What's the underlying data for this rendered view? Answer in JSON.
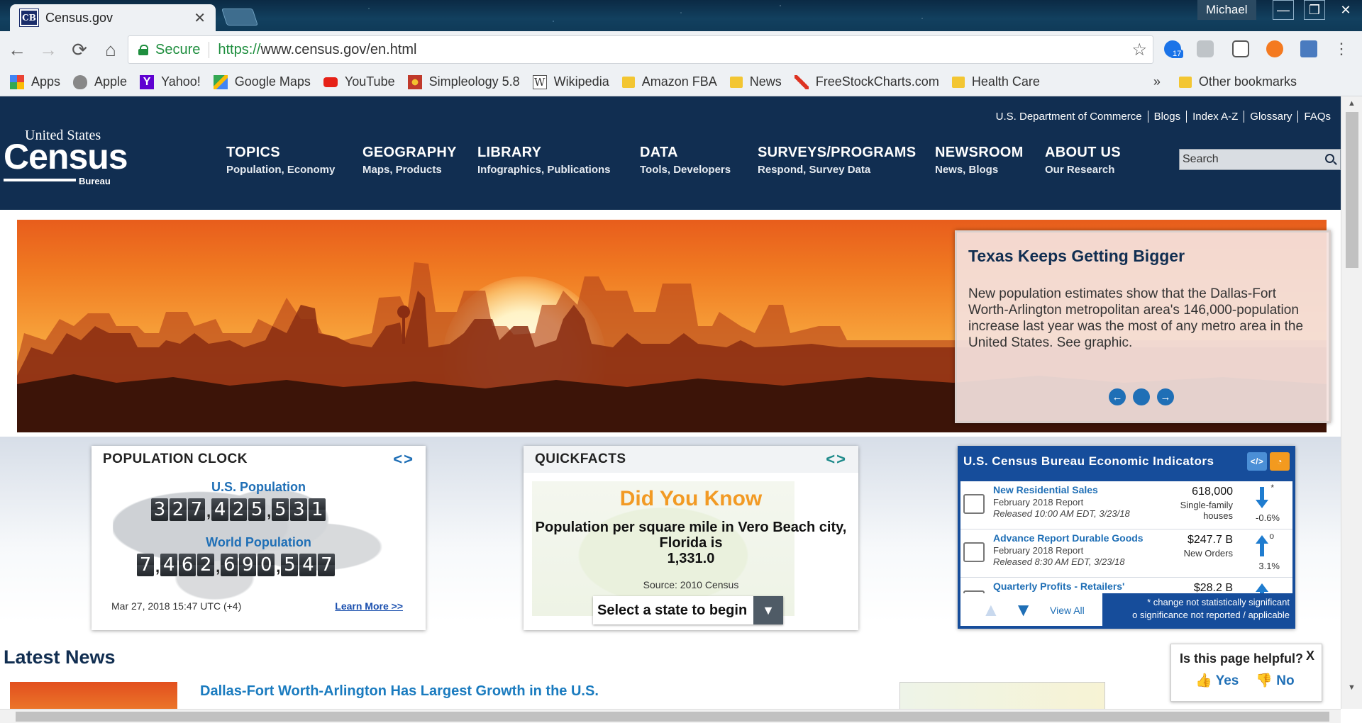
{
  "browser": {
    "tab_title": "Census.gov",
    "tab_favicon": "CB",
    "user": "Michael",
    "secure_label": "Secure",
    "url_scheme": "https://",
    "url_rest": "www.census.gov/en.html",
    "ext_badge": "17"
  },
  "bookmarks": [
    {
      "label": "Apps",
      "icon": "apps-grid-icon"
    },
    {
      "label": "Apple",
      "icon": "apple-icon"
    },
    {
      "label": "Yahoo!",
      "icon": "yahoo-icon"
    },
    {
      "label": "Google Maps",
      "icon": "maps-icon"
    },
    {
      "label": "YouTube",
      "icon": "youtube-icon"
    },
    {
      "label": "Simpleology 5.8",
      "icon": "simpleology-icon"
    },
    {
      "label": "Wikipedia",
      "icon": "wikipedia-icon"
    },
    {
      "label": "Amazon FBA",
      "icon": "folder-icon"
    },
    {
      "label": "News",
      "icon": "folder-icon"
    },
    {
      "label": "FreeStockCharts.com",
      "icon": "chart-icon"
    },
    {
      "label": "Health Care",
      "icon": "folder-icon"
    }
  ],
  "bookmarks_more": "»",
  "other_bookmarks": "Other bookmarks",
  "utility_links": [
    "U.S. Department of Commerce",
    "Blogs",
    "Index A-Z",
    "Glossary",
    "FAQs"
  ],
  "logo": {
    "top": "United States",
    "main": "Census",
    "bottom": "Bureau"
  },
  "nav": [
    {
      "title": "TOPICS",
      "sub": "Population, Economy"
    },
    {
      "title": "GEOGRAPHY",
      "sub": "Maps, Products"
    },
    {
      "title": "LIBRARY",
      "sub": "Infographics, Publications"
    },
    {
      "title": "DATA",
      "sub": "Tools, Developers"
    },
    {
      "title": "SURVEYS/PROGRAMS",
      "sub": "Respond, Survey Data"
    },
    {
      "title": "NEWSROOM",
      "sub": "News, Blogs"
    },
    {
      "title": "ABOUT US",
      "sub": "Our Research"
    }
  ],
  "search_placeholder": "Search",
  "hero": {
    "title": "Texas Keeps Getting Bigger",
    "body": "New population estimates show that the Dallas-Fort Worth-Arlington metropolitan area's 146,000-population increase last year was the most of any metro area in the United States. See graphic."
  },
  "population_clock": {
    "title": "POPULATION CLOCK",
    "us_label": "U.S. Population",
    "us_digits": [
      "3",
      "2",
      "7",
      ",",
      "4",
      "2",
      "5",
      ",",
      "5",
      "3",
      "1"
    ],
    "world_label": "World Population",
    "world_digits": [
      "7",
      ",",
      "4",
      "6",
      "2",
      ",",
      "6",
      "9",
      "0",
      ",",
      "5",
      "4",
      "7"
    ],
    "timestamp": "Mar 27, 2018 15:47 UTC (+4)",
    "learn_more": "Learn More >>"
  },
  "quickfacts": {
    "title": "QUICKFACTS",
    "heading": "Did You Know",
    "fact_line": "Population per square mile in Vero Beach city, Florida is",
    "fact_value": "1,331.0",
    "source": "Source: 2010 Census",
    "select": "Select a state to begin"
  },
  "economic": {
    "title": "U.S. Census Bureau Economic Indicators",
    "rows": [
      {
        "name": "New Residential Sales",
        "report": "February 2018 Report",
        "released": "Released 10:00 AM EDT, 3/23/18",
        "value": "618,000",
        "unit": "Single-family houses",
        "change": "-0.6%",
        "direction": "down",
        "mark": "*"
      },
      {
        "name": "Advance Report Durable Goods",
        "report": "February 2018 Report",
        "released": "Released 8:30 AM EDT, 3/23/18",
        "value": "$247.7 B",
        "unit": "New Orders",
        "change": "3.1%",
        "direction": "up",
        "mark": "o"
      },
      {
        "name": "Quarterly Profits - Retailers'",
        "report": "",
        "released": "",
        "value": "$28.2 B",
        "unit": "",
        "change": "",
        "direction": "up",
        "mark": ""
      }
    ],
    "view_all": "View All",
    "note1": "* change not statistically significant",
    "note2": "o significance not reported / applicable"
  },
  "latest_news": {
    "heading": "Latest News",
    "headline": "Dallas-Fort Worth-Arlington Has Largest Growth in the U.S."
  },
  "helpful": {
    "question": "Is this page helpful?",
    "yes": "Yes",
    "no": "No",
    "close": "X"
  }
}
